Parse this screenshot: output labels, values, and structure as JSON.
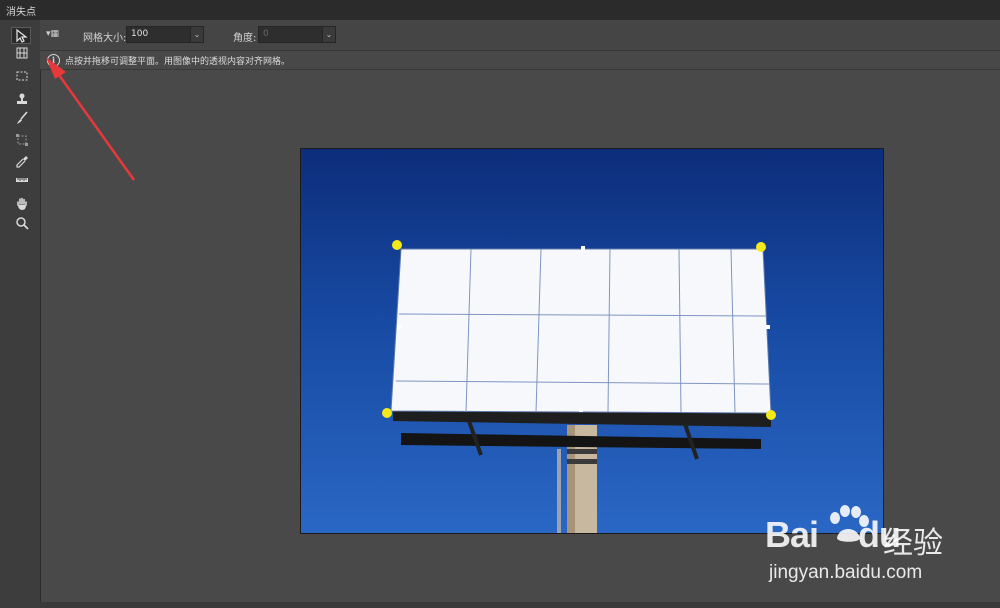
{
  "window": {
    "title": "消失点"
  },
  "options": {
    "grid_size_label": "网格大小:",
    "grid_size_value": "100",
    "angle_label": "角度:",
    "angle_value": "0"
  },
  "info": {
    "text": "点按并拖移可调整平面。用图像中的透视内容对齐网格。"
  },
  "tools": [
    "select-arrow-icon",
    "create-plane-icon",
    "marquee-icon",
    "stamp-icon",
    "brush-icon",
    "transform-icon",
    "eyedropper-icon",
    "measure-icon",
    "hand-icon",
    "zoom-icon"
  ],
  "colors": {
    "accent_handle": "#f4ea1a",
    "arrow": "#e8383a"
  },
  "watermark": {
    "logo": "Bai",
    "logo_suffix": "du",
    "cn": "经验",
    "url": "jingyan.baidu.com"
  }
}
